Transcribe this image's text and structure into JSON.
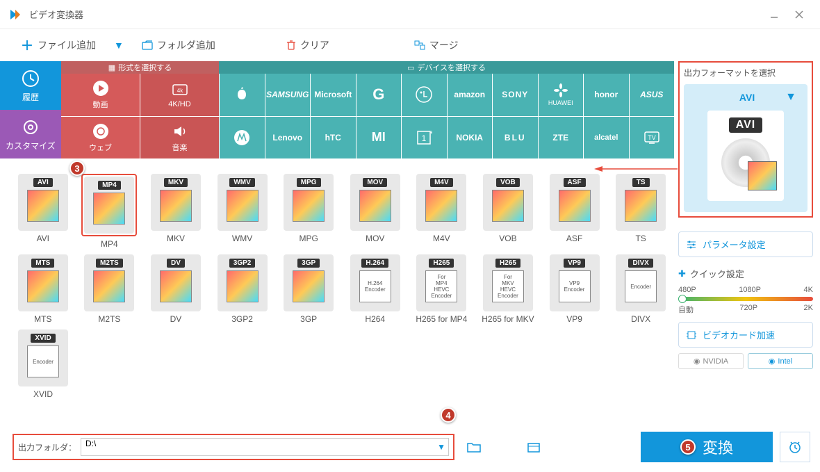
{
  "app": {
    "title": "ビデオ変換器"
  },
  "toolbar": {
    "add_file": "ファイル追加",
    "add_folder": "フォルダ追加",
    "clear": "クリア",
    "merge": "マージ"
  },
  "sidebar": {
    "history": "履歴",
    "customize": "カスタマイズ"
  },
  "tabs": {
    "format": "形式を選択する",
    "device": "デバイスを選択する"
  },
  "categories": {
    "video": "動画",
    "hd": "4K/HD",
    "web": "ウェブ",
    "audio": "音楽",
    "brands": [
      "Apple",
      "SAMSUNG",
      "Microsoft",
      "G",
      "LG",
      "amazon",
      "SONY",
      "HUAWEI",
      "honor",
      "ASUS",
      "Motorola",
      "Lenovo",
      "hTC",
      "MI",
      "OnePlus",
      "NOKIA",
      "BLU",
      "ZTE",
      "alcatel",
      "TV"
    ]
  },
  "formats": {
    "row1": [
      "AVI",
      "MP4",
      "MKV",
      "WMV",
      "MPG",
      "MOV",
      "M4V",
      "VOB",
      "ASF",
      "TS"
    ],
    "row2": [
      "MTS",
      "M2TS",
      "DV",
      "3GP2",
      "3GP",
      "H264",
      "H265 for MP4",
      "H265 for MKV",
      "VP9",
      "DIVX"
    ],
    "row2_badges": [
      "MTS",
      "M2TS",
      "DV",
      "3GP2",
      "3GP",
      "H.264",
      "H265",
      "H265",
      "VP9",
      "DIVX"
    ],
    "row2_sub": [
      "",
      "",
      "",
      "",
      "",
      "H.264 Encoder",
      "For MP4 HEVC Encoder",
      "For MKV HEVC Encoder",
      "VP9 Encoder",
      "Encoder"
    ],
    "row3": [
      "XVID"
    ],
    "row3_sub": [
      "Encoder"
    ],
    "selected": "MP4"
  },
  "rightpanel": {
    "title": "出力フォーマットを選択",
    "current": "AVI",
    "params": "パラメータ設定",
    "quick": "クイック設定",
    "resolutions_top": [
      "480P",
      "1080P",
      "4K"
    ],
    "resolutions_bottom": [
      "自動",
      "720P",
      "2K"
    ],
    "gpu": "ビデオカード加速",
    "gpu_chips": [
      "NVIDIA",
      "Intel"
    ]
  },
  "bottom": {
    "label": "出力フォルダ：",
    "path": "D:\\",
    "convert": "変換"
  },
  "annotations": {
    "n3": "3",
    "n4": "4",
    "n5": "5"
  }
}
